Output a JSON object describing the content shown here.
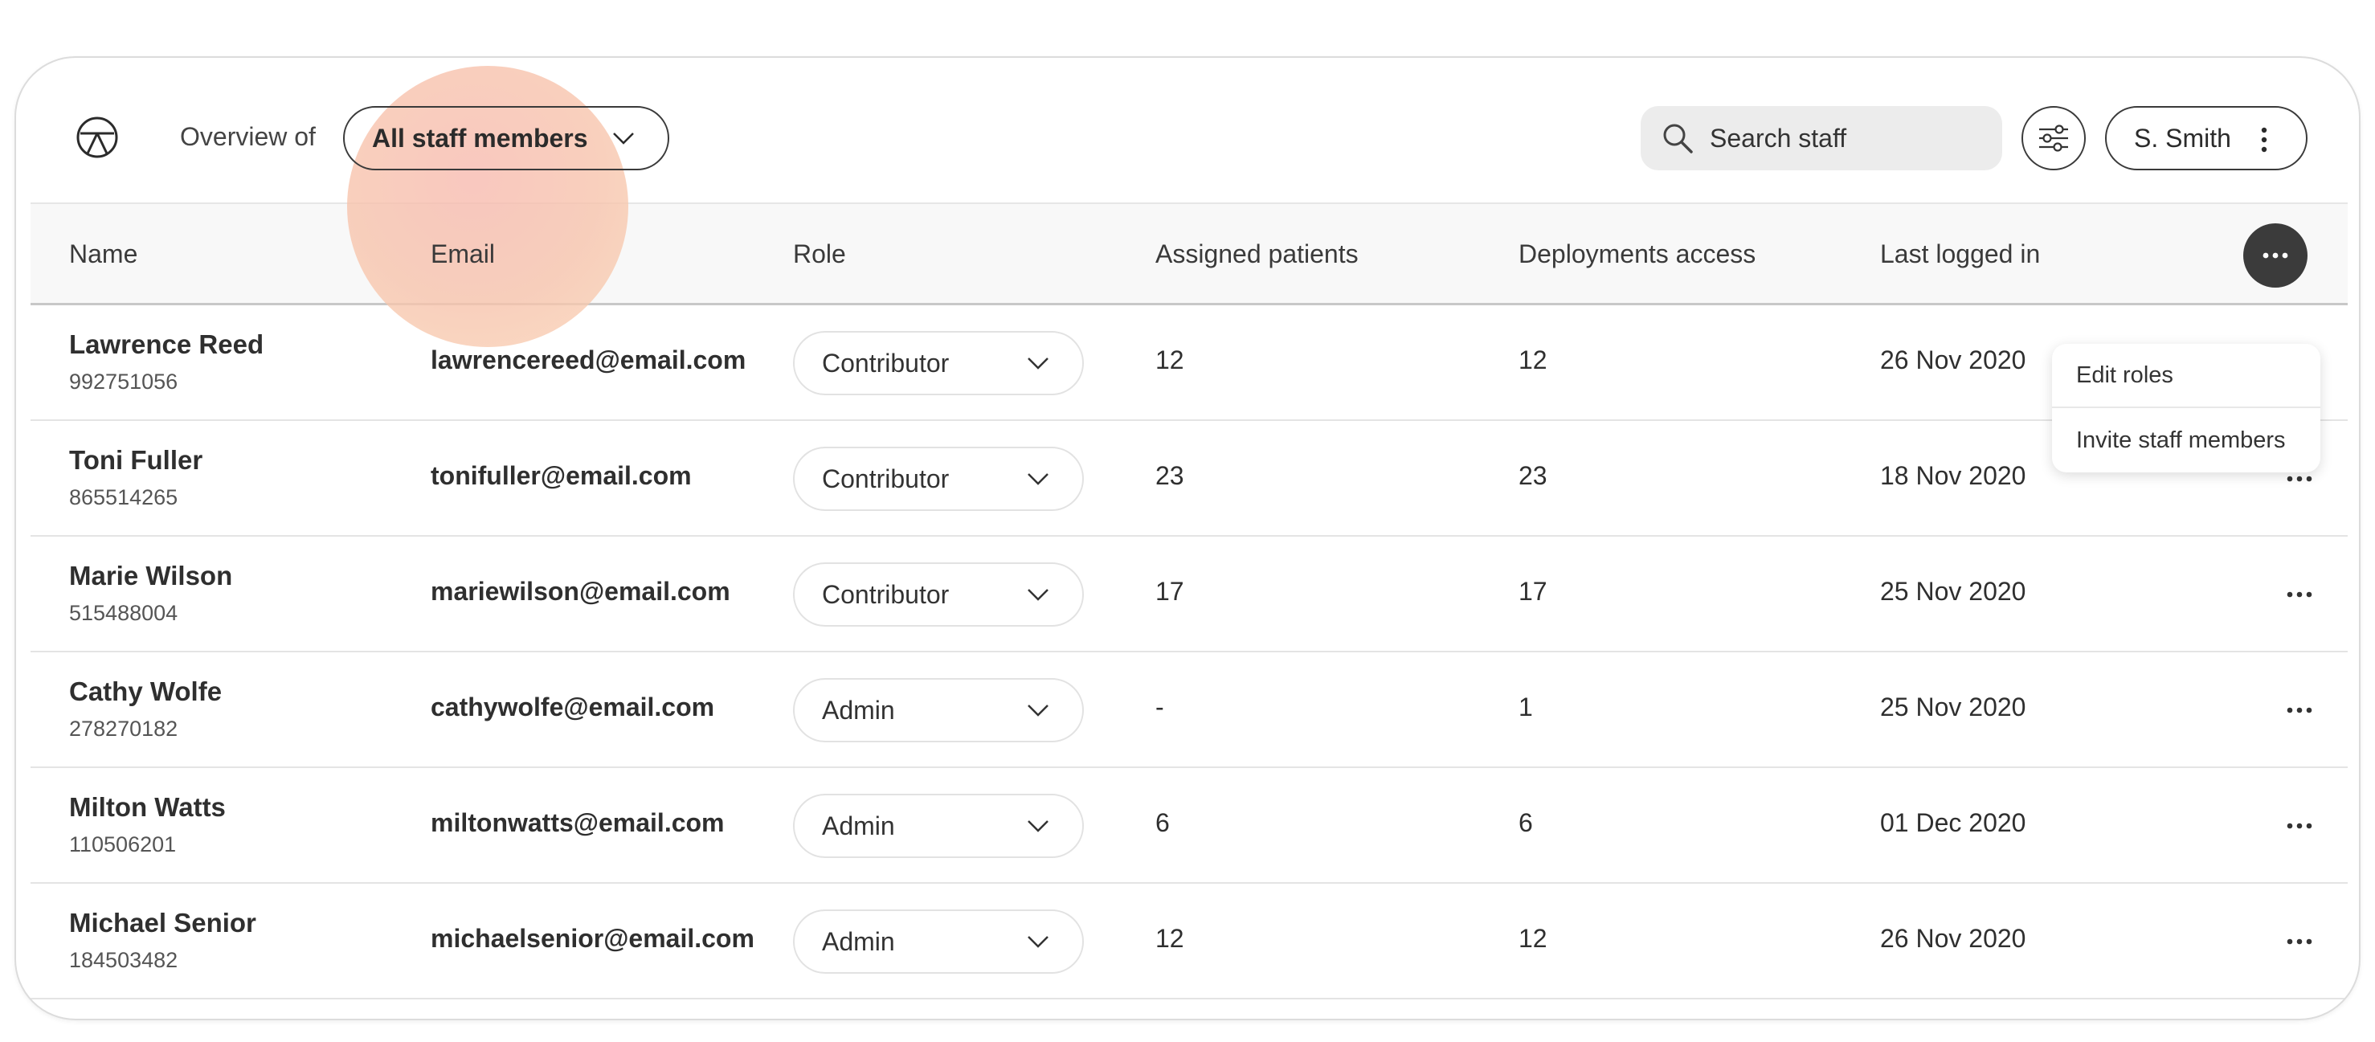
{
  "toolbar": {
    "overview_label": "Overview of",
    "staff_filter_value": "All staff members",
    "search_placeholder": "Search staff",
    "user_name": "S. Smith"
  },
  "table": {
    "headers": {
      "name": "Name",
      "email": "Email",
      "role": "Role",
      "assigned_patients": "Assigned patients",
      "deployments_access": "Deployments access",
      "last_logged_in": "Last logged in"
    },
    "rows": [
      {
        "name": "Lawrence Reed",
        "id": "992751056",
        "email": "lawrencereed@email.com",
        "role": "Contributor",
        "assigned_patients": "12",
        "deployments_access": "12",
        "last_logged_in": "26 Nov 2020"
      },
      {
        "name": "Toni Fuller",
        "id": "865514265",
        "email": "tonifuller@email.com",
        "role": "Contributor",
        "assigned_patients": "23",
        "deployments_access": "23",
        "last_logged_in": "18 Nov 2020"
      },
      {
        "name": "Marie Wilson",
        "id": "515488004",
        "email": "mariewilson@email.com",
        "role": "Contributor",
        "assigned_patients": "17",
        "deployments_access": "17",
        "last_logged_in": "25 Nov 2020"
      },
      {
        "name": "Cathy Wolfe",
        "id": "278270182",
        "email": "cathywolfe@email.com",
        "role": "Admin",
        "assigned_patients": "-",
        "deployments_access": "1",
        "last_logged_in": "25 Nov 2020"
      },
      {
        "name": "Milton Watts",
        "id": "110506201",
        "email": "miltonwatts@email.com",
        "role": "Admin",
        "assigned_patients": "6",
        "deployments_access": "6",
        "last_logged_in": "01 Dec 2020"
      },
      {
        "name": "Michael Senior",
        "id": "184503482",
        "email": "michaelsenior@email.com",
        "role": "Admin",
        "assigned_patients": "12",
        "deployments_access": "12",
        "last_logged_in": "26 Nov 2020"
      }
    ]
  },
  "popup_menu": {
    "items": [
      "Edit roles",
      "Invite staff members"
    ]
  },
  "colors": {
    "highlight": "#f7bcae",
    "dark_button": "#3b3b3b",
    "search_bg": "#ececec"
  },
  "icons": {
    "logo": "peace-circle-icon",
    "search": "search-icon",
    "filter": "sliders-icon",
    "kebab": "kebab-vertical-icon",
    "more": "more-horizontal-icon",
    "chevron": "chevron-down-icon"
  }
}
